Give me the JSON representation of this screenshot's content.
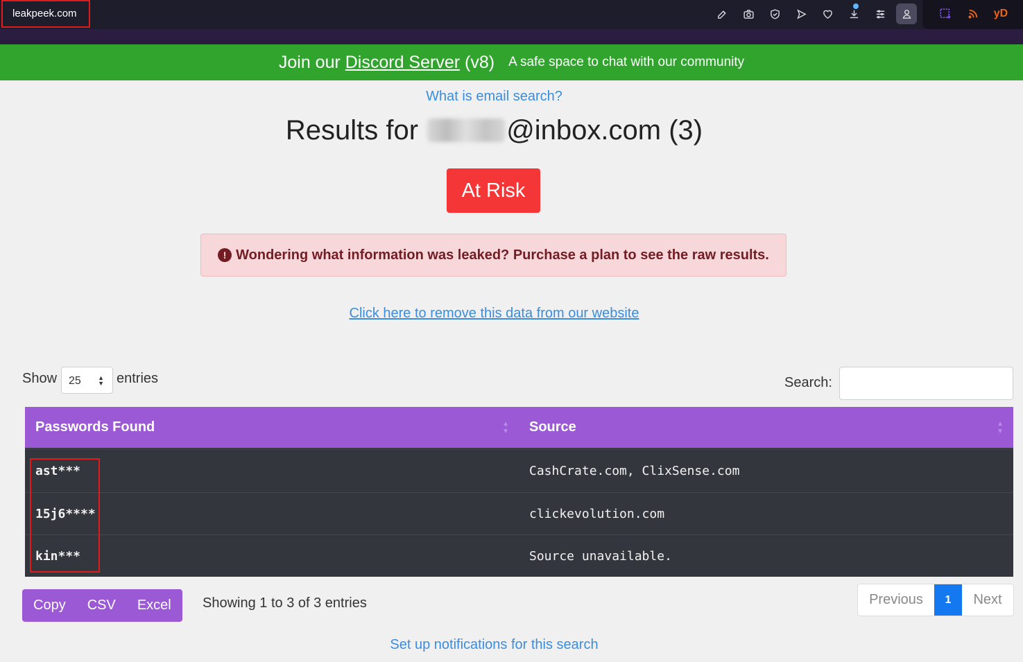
{
  "browser": {
    "url": "leakpeek.com",
    "toolbar_icons": [
      "edit-icon",
      "camera-icon",
      "shield-icon",
      "send-icon",
      "heart-icon",
      "download-icon",
      "sliders-icon",
      "profile-icon"
    ],
    "extensions": [
      "crop-icon",
      "rss-icon",
      "yd-icon"
    ],
    "ext_yd_label": "yD"
  },
  "banner": {
    "prefix": "Join our ",
    "link": "Discord Server",
    "suffix": " (v8)",
    "subtitle": "A safe space to chat with our community"
  },
  "header": {
    "what_link": "What is email search?",
    "results_prefix": "Results for ",
    "results_suffix": "@inbox.com (3)",
    "risk_label": "At Risk"
  },
  "alert": {
    "text": "Wondering what information was leaked? Purchase a plan to see the raw results.",
    "icon": "!"
  },
  "remove_link": "Click here to remove this data from our website",
  "controls": {
    "show_label": "Show",
    "page_size": "25",
    "entries_label": "entries",
    "search_label": "Search:",
    "search_value": ""
  },
  "table": {
    "headers": [
      "Passwords Found",
      "Source"
    ],
    "rows": [
      {
        "password": "ast***",
        "source": "CashCrate.com, ClixSense.com"
      },
      {
        "password": "15j6****",
        "source": "clickevolution.com"
      },
      {
        "password": "kin***",
        "source": "Source unavailable."
      }
    ]
  },
  "footer": {
    "buttons": [
      "Copy",
      "CSV",
      "Excel"
    ],
    "showing": "Showing 1 to 3 of 3 entries",
    "pager": {
      "prev": "Previous",
      "current": "1",
      "next": "Next"
    },
    "notify_link": "Set up notifications for this search"
  },
  "colors": {
    "banner": "#31a42e",
    "risk": "#f53636",
    "table_header": "#9b59d6",
    "link": "#3a8dde",
    "pager_active": "#1478f0"
  }
}
